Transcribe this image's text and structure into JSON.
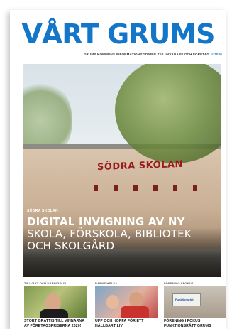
{
  "masthead": {
    "title": "VÅRT GRUMS",
    "title_color": "#1476c8",
    "subline": "GRUMS KOMMUNS INFORMATIONSTIDNING TILL INVÅNARE OCH FÖRETAG",
    "issue": "1/ 2020"
  },
  "cover": {
    "sign_text": "SÖDRA SKOLAN",
    "kicker": "SÖDRA SKOLAN",
    "headline_bold": "DIGITAL INVIGNING AV NY",
    "headline_light_1": "SKOLA, FÖRSKOLA, BIBLIOTEK",
    "headline_light_2": "OCH SKOLGÅRD"
  },
  "teasers": [
    {
      "label": "TILLVÄXT OCH NÄRINGSLIV",
      "title": "STORT GRATTIS TILL VINNARNA AV FÖRETAGSPRISERNA 2020!",
      "icon": "person-photo"
    },
    {
      "label": "BARNS HÄLSA",
      "title": "UPP OCH HOPPA FÖR ETT HÅLLBART LIV",
      "icon": "children-photo"
    },
    {
      "label": "FÖRENING I FOKUS",
      "title": "FÖRENING I FOKUS FUNKTIONSRÄTT GRUMS",
      "icon": "sign-photo"
    }
  ],
  "teaser3_plaque": "Funktionsrätt"
}
